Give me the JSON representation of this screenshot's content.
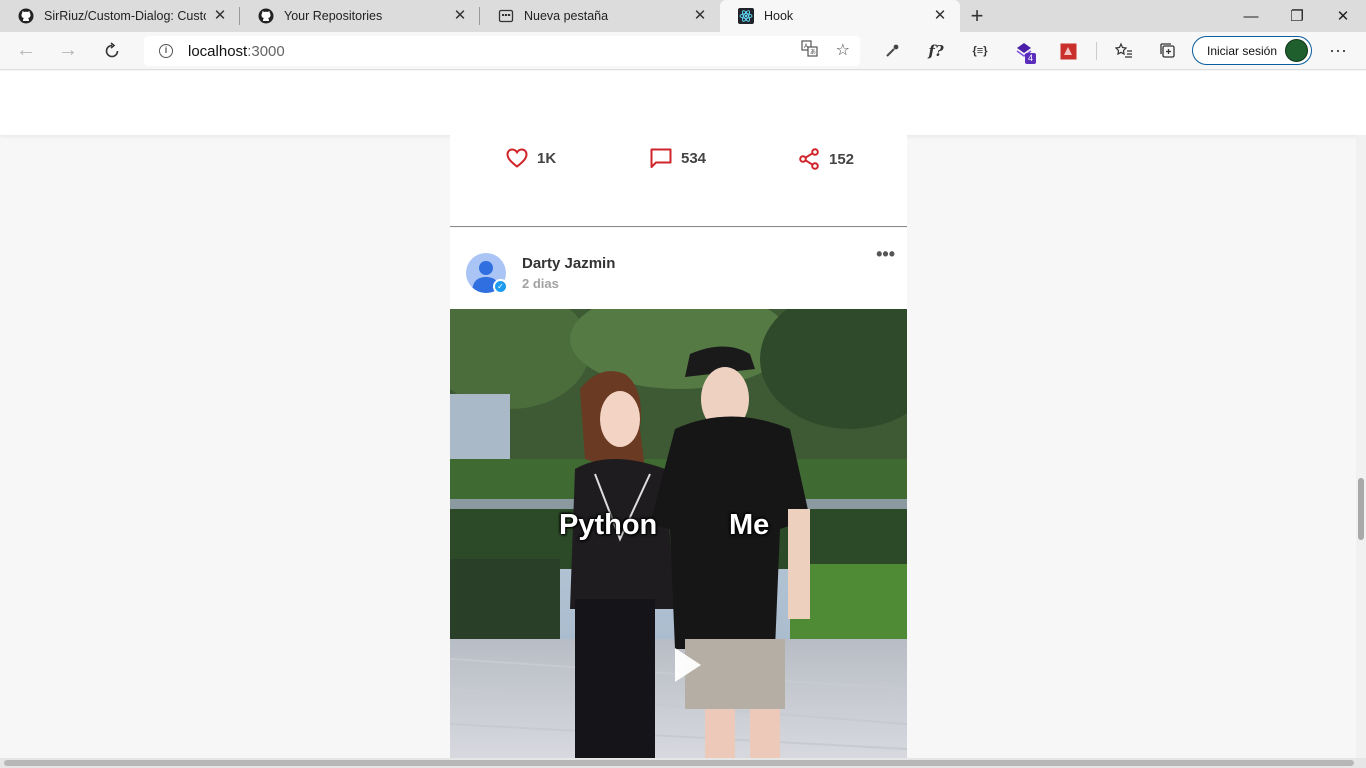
{
  "browser": {
    "tabs": [
      {
        "title": "SirRiuz/Custom-Dialog: Custom",
        "icon": "github-icon",
        "active": false
      },
      {
        "title": "Your Repositories",
        "icon": "github-icon",
        "active": false
      },
      {
        "title": "Nueva pestaña",
        "icon": "newtab-icon",
        "active": false
      },
      {
        "title": "Hook",
        "icon": "react-icon",
        "active": true
      }
    ],
    "address": {
      "host": "localhost",
      "port": ":3000"
    },
    "signin_label": "Iniciar sesión",
    "extension_badge": "4",
    "fx_label": "f?",
    "json_label": "{≡}"
  },
  "feed": {
    "prev_post_stats": {
      "likes": "1K",
      "comments": "534",
      "shares": "152"
    },
    "post": {
      "author": "Darty Jazmin",
      "time_ago": "2 dias",
      "caption_left": "Python",
      "caption_right": "Me"
    }
  },
  "colors": {
    "accent_red": "#d0242b",
    "verified_blue": "#1d9bf0",
    "signin_border": "#0a5d9e"
  }
}
